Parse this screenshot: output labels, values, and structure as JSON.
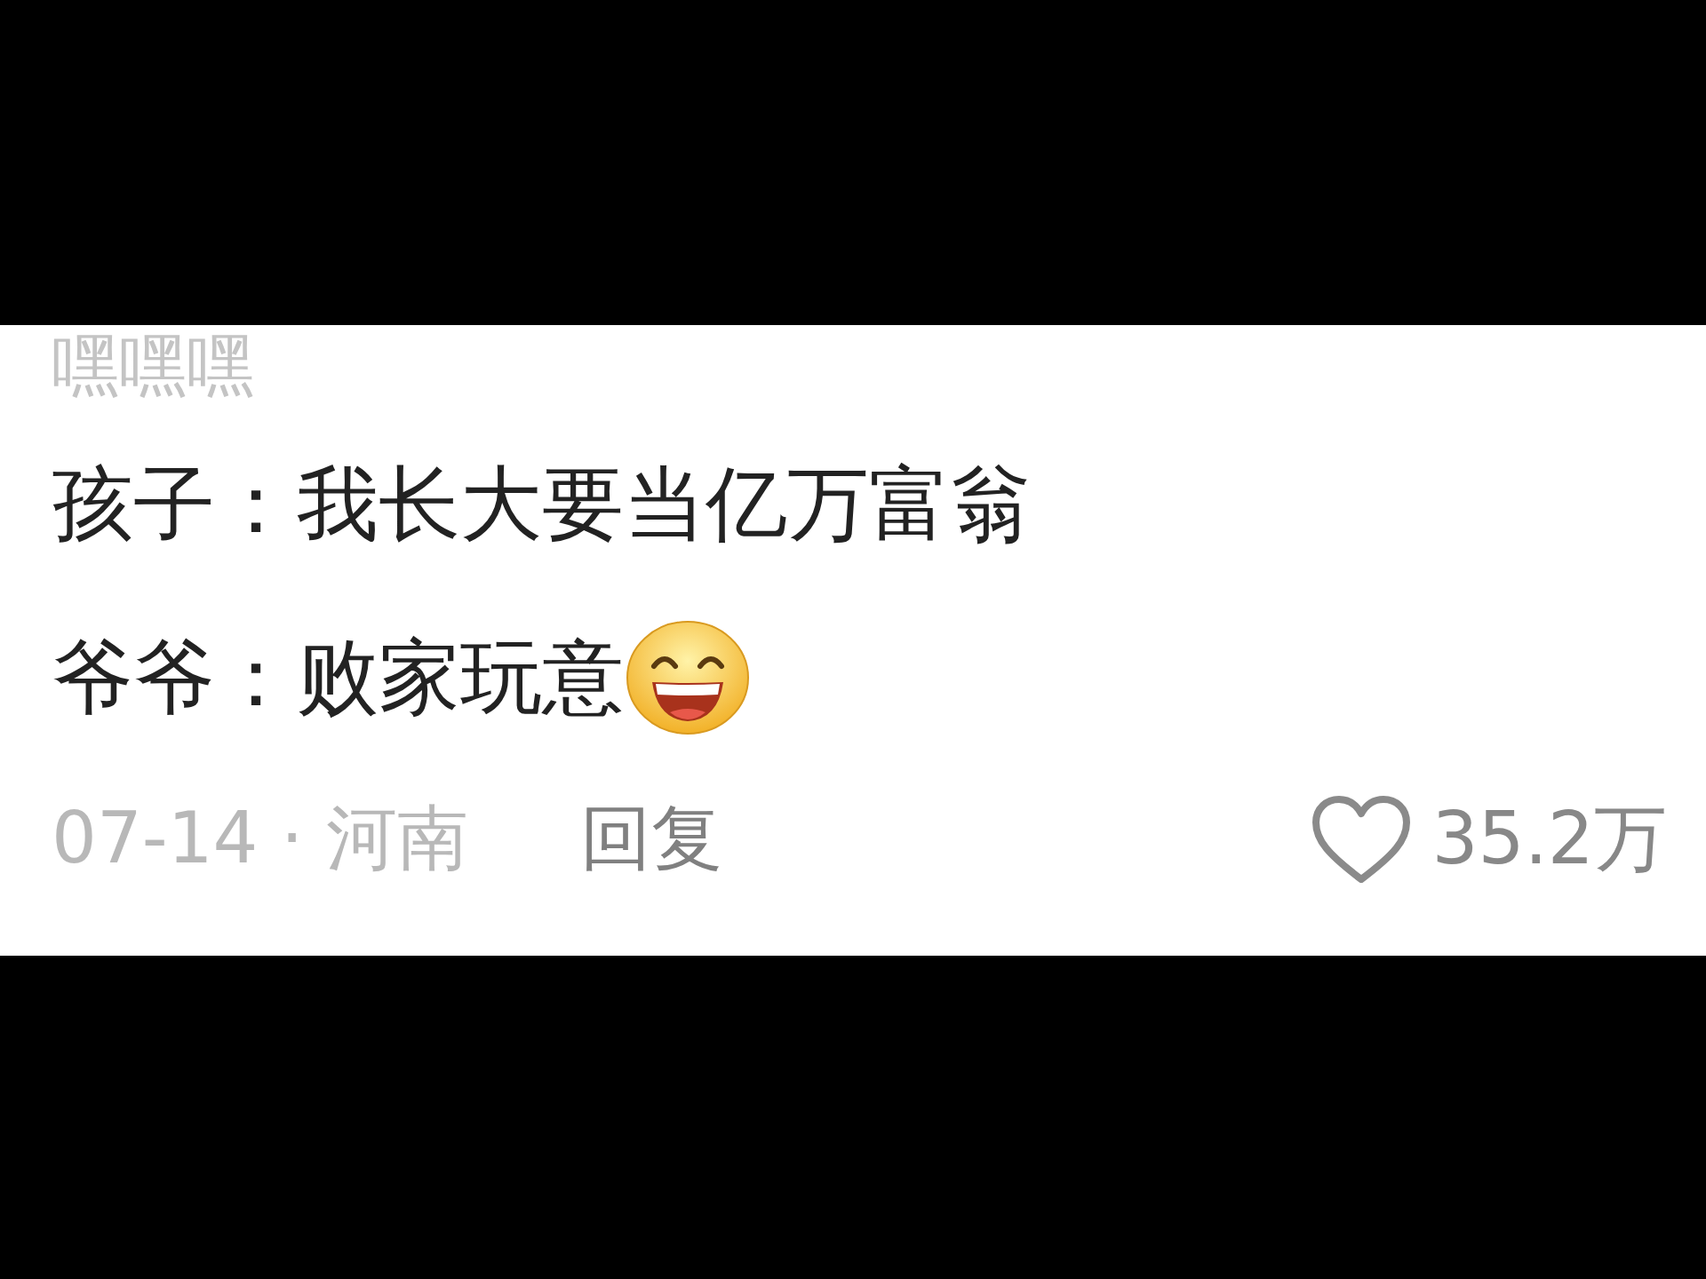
{
  "comment": {
    "username": "嘿嘿嘿",
    "lines": [
      "孩子：我长大要当亿万富翁",
      "爷爷：败家玩意"
    ],
    "meta": "07-14 · 河南",
    "reply": "回复",
    "liked": false,
    "likes": "35.2万"
  }
}
